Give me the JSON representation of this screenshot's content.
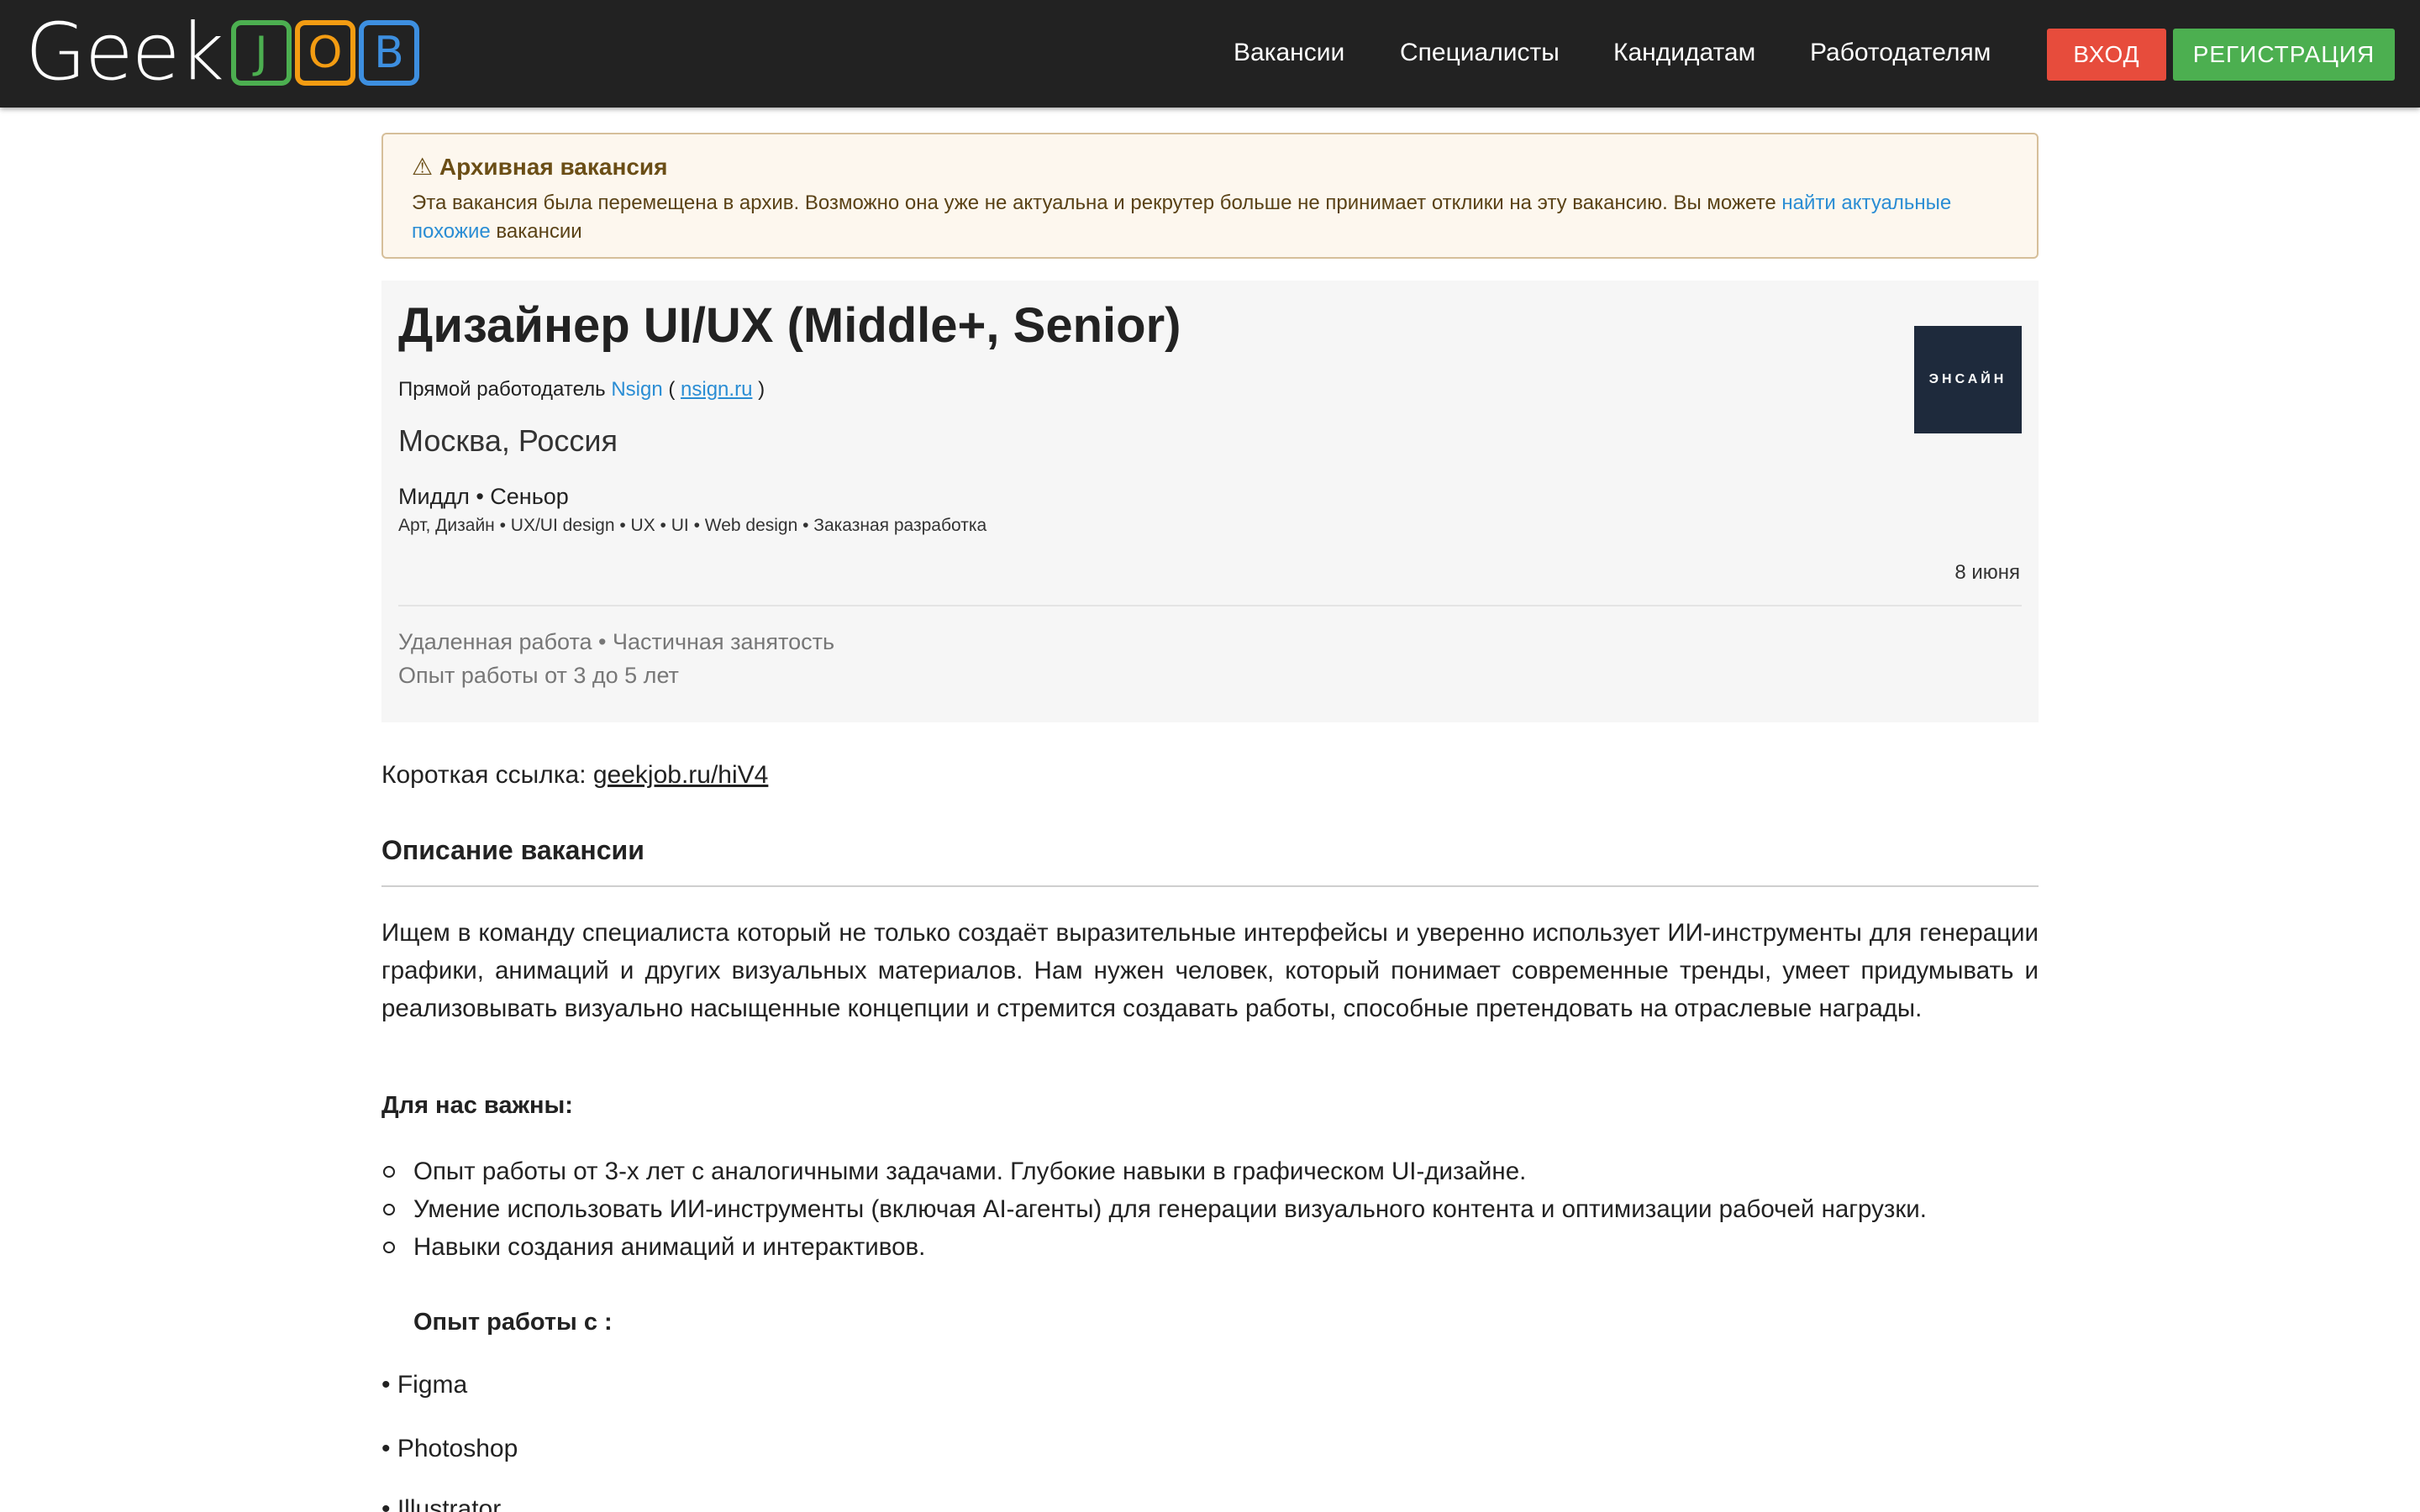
{
  "header": {
    "logo": {
      "text": "Geek",
      "letters": [
        "J",
        "O",
        "B"
      ]
    },
    "nav": [
      "Вакансии",
      "Специалисты",
      "Кандидатам",
      "Работодателям"
    ],
    "login_label": "ВХОД",
    "register_label": "РЕГИСТРАЦИЯ",
    "colors": {
      "bar": "#222222",
      "login": "#e74c3c",
      "register": "#4caf50"
    }
  },
  "alert": {
    "icon": "warning-icon",
    "title": "Архивная вакансия",
    "text": "Эта вакансия была перемещена в архив. Возможно она уже не актуальна и рекрутер больше не принимает отклики на эту вакансию. Вы можете",
    "link": "найти актуальные похожие",
    "tail": "вакансии"
  },
  "job": {
    "title": "Дизайнер UI/UX (Middle+, Senior)",
    "employer_prefix": "Прямой работодатель",
    "company": "Nsign",
    "open_paren": "(",
    "site": "nsign.ru",
    "close_paren": ")",
    "city": "Москва, Россия",
    "levels": "Миддл • Сеньор",
    "tags": "Арт, Дизайн • UX/UI design • UX • UI • Web design • Заказная разработка",
    "date": "8 июня",
    "work_format": "Удаленная работа • Частичная занятость",
    "experience": "Опыт работы от 3 до 5 лет",
    "company_logo_text": "ЭНСАЙН"
  },
  "content": {
    "short_link_label": "Короткая ссылка:",
    "short_link": "geekjob.ru/hiV4",
    "section_title": "Описание вакансии",
    "description": "Ищем в команду специалиста который не только создаёт выразительные интерфейсы и уверенно использует ИИ-инструменты для генерации графики, анимаций и других визуальных материалов. Нам нужен человек, который понимает современные тренды, умеет придумывать и реализовывать визуально насыщенные концепции и стремится создавать работы, способные претендовать на отраслевые награды.",
    "important_title": "Для нас важны:",
    "requirements": [
      "Опыт работы от 3-х лет с аналогичными задачами. Глубокие навыки в графическом UI-дизайне.",
      "Умение использовать ИИ-инструменты (включая AI-агенты) для генерации визуального контента и оптимизации рабочей нагрузки.",
      "Навыки создания анимаций и интерактивов."
    ],
    "experience_title": "Опыт работы с :",
    "tools": [
      "• Figma",
      "• Photoshop",
      "• Illustrator"
    ]
  }
}
